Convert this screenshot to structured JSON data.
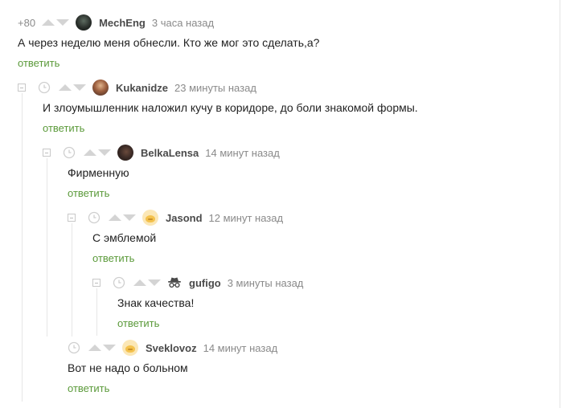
{
  "comments": [
    {
      "rating": "+80",
      "user": "MechEng",
      "time": "3 часа назад",
      "text": "А через неделю меня обнесли. Кто же мог это сделать,а?",
      "reply": "ответить"
    },
    {
      "user": "Kukanidze",
      "time": "23 минуты назад",
      "text": "И злоумышленник наложил кучу в коридоре, до боли знакомой формы.",
      "reply": "ответить"
    },
    {
      "user": "BelkaLensa",
      "time": "14 минут назад",
      "text": "Фирменную",
      "reply": "ответить"
    },
    {
      "user": "Jasond",
      "time": "12 минут назад",
      "text": "С эмблемой",
      "reply": "ответить"
    },
    {
      "user": "gufigo",
      "time": "3 минуты назад",
      "text": "Знак качества!",
      "reply": "ответить"
    },
    {
      "user": "Sveklovoz",
      "time": "14 минут назад",
      "text": "Вот не надо о больном",
      "reply": "ответить"
    }
  ],
  "icons": {
    "collapse": "collapse-minus-icon",
    "clock": "clock-icon",
    "vote_up": "arrow-up-icon",
    "vote_down": "arrow-down-icon",
    "incognito": "incognito-hat-icon"
  },
  "colors": {
    "reply_link": "#5b9a3a",
    "username": "#4a4a4a",
    "meta": "#8a8a8a",
    "vote_arrow": "#d4d4d4",
    "thread_line": "#e6e6e6"
  }
}
